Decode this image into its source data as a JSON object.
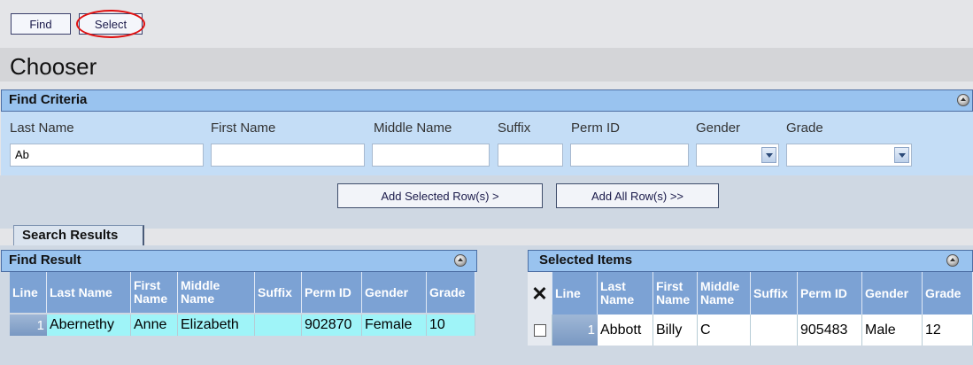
{
  "toolbar": {
    "find_label": "Find",
    "select_label": "Select"
  },
  "page": {
    "title": "Chooser"
  },
  "find_criteria": {
    "title": "Find Criteria",
    "labels": {
      "last_name": "Last Name",
      "first_name": "First Name",
      "middle_name": "Middle Name",
      "suffix": "Suffix",
      "perm_id": "Perm ID",
      "gender": "Gender",
      "grade": "Grade"
    },
    "values": {
      "last_name": "Ab",
      "first_name": "",
      "middle_name": "",
      "suffix": "",
      "perm_id": "",
      "gender": "",
      "grade": ""
    }
  },
  "actions": {
    "add_selected": "Add Selected Row(s) >",
    "add_all": "Add All Row(s) >>"
  },
  "tabs": {
    "search_results": "Search Results"
  },
  "find_result": {
    "title": "Find Result",
    "columns": {
      "line": "Line",
      "last_name": "Last Name",
      "first_name": "First Name",
      "middle_name": "Middle Name",
      "suffix": "Suffix",
      "perm_id": "Perm ID",
      "gender": "Gender",
      "grade": "Grade"
    },
    "rows": [
      {
        "line": "1",
        "last_name": "Abernethy",
        "first_name": "Anne",
        "middle_name": "Elizabeth",
        "suffix": "",
        "perm_id": "902870",
        "gender": "Female",
        "grade": "10"
      }
    ]
  },
  "selected_items": {
    "title": "Selected Items",
    "remove_all_symbol": "✕",
    "columns": {
      "line": "Line",
      "last_name": "Last Name",
      "first_name": "First Name",
      "middle_name": "Middle Name",
      "suffix": "Suffix",
      "perm_id": "Perm ID",
      "gender": "Gender",
      "grade": "Grade"
    },
    "rows": [
      {
        "line": "1",
        "last_name": "Abbott",
        "first_name": "Billy",
        "middle_name": "C",
        "suffix": "",
        "perm_id": "905483",
        "gender": "Male",
        "grade": "12"
      }
    ]
  },
  "colors": {
    "panel_header": "#99c3ef",
    "column_header": "#7ca2d4",
    "result_row": "#9ff4f8",
    "highlight_ring": "#e01010"
  }
}
